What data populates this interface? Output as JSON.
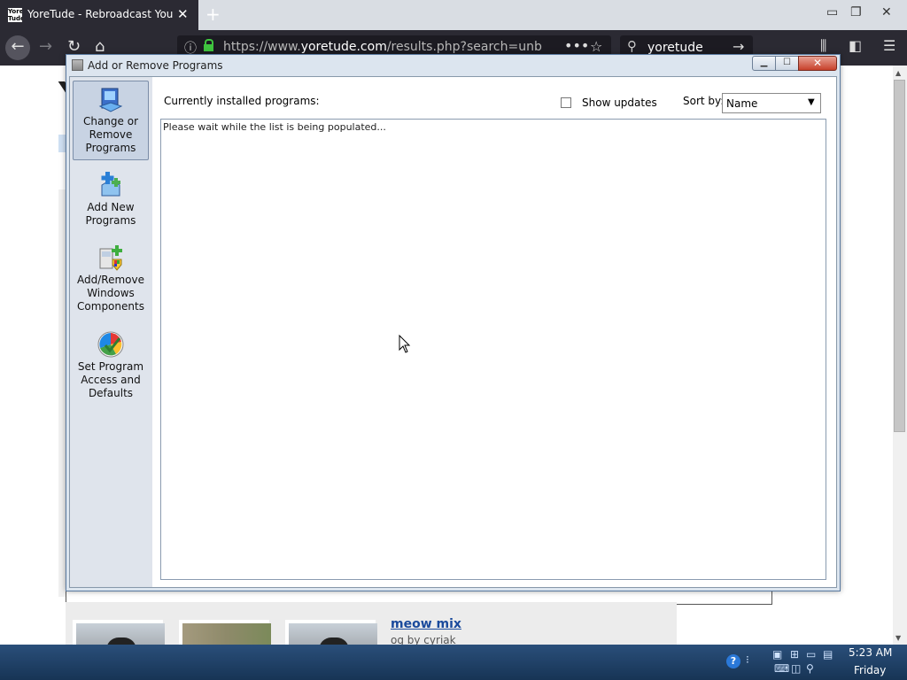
{
  "browser": {
    "tab_title": "YoreTude - Rebroadcast Yourself",
    "favicon_text": "Yore Tude",
    "url_prefix": "https://www.",
    "url_domain": "yoretude.com",
    "url_path": "/results.php?search=unbreakif",
    "search_text": "yoretude"
  },
  "page": {
    "video_title": "meow mix",
    "video_byline": "og by cyriak"
  },
  "dialog": {
    "title": "Add or Remove Programs",
    "tasks": [
      {
        "label": "Change or Remove Programs",
        "icon": "change-remove-programs-icon"
      },
      {
        "label": "Add New Programs",
        "icon": "add-new-programs-icon"
      },
      {
        "label": "Add/Remove Windows Components",
        "icon": "windows-components-icon"
      },
      {
        "label": "Set Program Access and Defaults",
        "icon": "program-access-defaults-icon"
      }
    ],
    "installed_label": "Currently installed programs:",
    "show_updates_label": "Show updates",
    "show_updates_checked": false,
    "sort_by_label": "Sort by:",
    "sort_by_value": "Name",
    "list_message": "Please wait while the list is being populated..."
  },
  "taskbar": {
    "time": "5:23 AM",
    "day": "Friday"
  }
}
